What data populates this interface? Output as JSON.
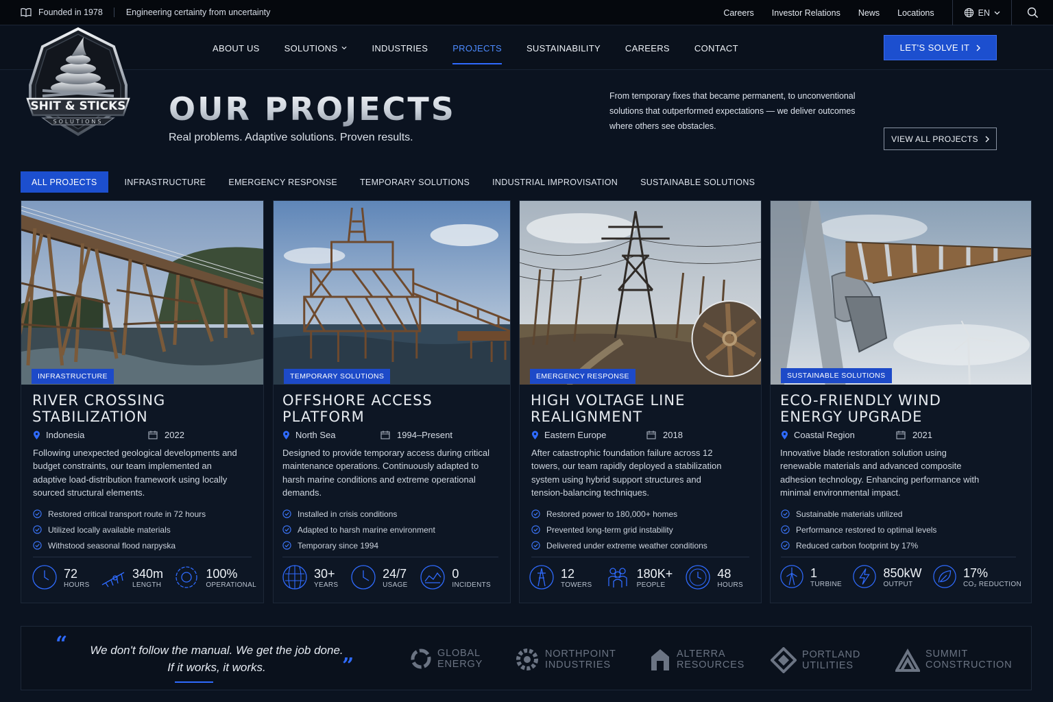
{
  "topbar": {
    "founded": "Founded in 1978",
    "tagline": "Engineering certainty from uncertainty",
    "links": [
      "Careers",
      "Investor Relations",
      "News",
      "Locations"
    ],
    "language": "EN"
  },
  "brand": {
    "name": "SHIT & STICKS",
    "sub": "SOLUTIONS"
  },
  "nav": {
    "items": [
      "ABOUT US",
      "SOLUTIONS",
      "INDUSTRIES",
      "PROJECTS",
      "SUSTAINABILITY",
      "CAREERS",
      "CONTACT"
    ],
    "active": "PROJECTS",
    "cta": "LET'S SOLVE IT"
  },
  "hero": {
    "title": "OUR PROJECTS",
    "subtitle": "Real problems. Adaptive solutions. Proven results.",
    "description": "From temporary fixes that became permanent, to unconventional solutions that outperformed expectations — we deliver outcomes where others see obstacles.",
    "view_all": "VIEW ALL PROJECTS"
  },
  "filters": [
    "ALL PROJECTS",
    "INFRASTRUCTURE",
    "EMERGENCY RESPONSE",
    "TEMPORARY SOLUTIONS",
    "INDUSTRIAL IMPROVISATION",
    "SUSTAINABLE SOLUTIONS"
  ],
  "projects": [
    {
      "badge": "INFRASTRUCTURE",
      "title_1": "RIVER CROSSING",
      "title_2": "STABILIZATION",
      "location": "Indonesia",
      "year": "2022",
      "description": "Following unexpected geological developments and budget constraints, our team implemented an adaptive load-distribution framework using locally sourced structural elements.",
      "checks": [
        "Restored critical transport route in 72 hours",
        "Utilized locally available materials",
        "Withstood seasonal flood narpyska"
      ],
      "stats": [
        {
          "value": "72",
          "label": "HOURS",
          "icon": "clock-icon"
        },
        {
          "value": "340m",
          "label": "LENGTH",
          "icon": "bridge-icon"
        },
        {
          "value": "100%",
          "label": "OPERATIONAL",
          "icon": "gear-icon"
        }
      ]
    },
    {
      "badge": "TEMPORARY SOLUTIONS",
      "title_1": "OFFSHORE ACCESS",
      "title_2": "PLATFORM",
      "location": "North Sea",
      "year": "1994–Present",
      "description": "Designed to provide temporary access during critical maintenance operations. Continuously adapted to harsh marine conditions and extreme operational demands.",
      "checks": [
        "Installed in crisis conditions",
        "Adapted to harsh marine environment",
        "Temporary since 1994"
      ],
      "stats": [
        {
          "value": "30+",
          "label": "YEARS",
          "icon": "globe-icon"
        },
        {
          "value": "24/7",
          "label": "USAGE",
          "icon": "clock-icon"
        },
        {
          "value": "0",
          "label": "INCIDENTS",
          "icon": "chart-icon"
        }
      ]
    },
    {
      "badge": "EMERGENCY RESPONSE",
      "title_1": "HIGH VOLTAGE LINE",
      "title_2": "REALIGNMENT",
      "location": "Eastern Europe",
      "year": "2018",
      "description": "After catastrophic foundation failure across 12 towers, our team rapidly deployed a stabilization system using hybrid support structures and tension-balancing techniques.",
      "checks": [
        "Restored power to 180,000+ homes",
        "Prevented long-term grid instability",
        "Delivered under extreme weather conditions"
      ],
      "stats": [
        {
          "value": "12",
          "label": "TOWERS",
          "icon": "tower-icon"
        },
        {
          "value": "180K+",
          "label": "PEOPLE",
          "icon": "people-icon"
        },
        {
          "value": "48",
          "label": "HOURS",
          "icon": "clock-icon"
        }
      ]
    },
    {
      "badge": "SUSTAINABLE SOLUTIONS",
      "title_1": "ECO-FRIENDLY WIND",
      "title_2": "ENERGY UPGRADE",
      "location": "Coastal Region",
      "year": "2021",
      "description": "Innovative blade restoration solution using renewable materials and advanced composite adhesion technology. Enhancing performance with minimal environmental impact.",
      "checks": [
        "Sustainable materials utilized",
        "Performance restored to optimal levels",
        "Reduced carbon footprint by 17%"
      ],
      "stats": [
        {
          "value": "1",
          "label": "TURBINE",
          "icon": "turbine-icon"
        },
        {
          "value": "850kW",
          "label": "OUTPUT",
          "icon": "bolt-icon"
        },
        {
          "value": "17%",
          "label": "CO₂ REDUCTION",
          "icon": "leaf-icon"
        }
      ]
    }
  ],
  "quote": {
    "line1": "We don't follow the manual. We get the job done.",
    "line2": "If it works, it works."
  },
  "partners": [
    {
      "l1": "GLOBAL",
      "l2": "ENERGY"
    },
    {
      "l1": "NORTHPOINT",
      "l2": "INDUSTRIES"
    },
    {
      "l1": "ALTERRA",
      "l2": "RESOURCES"
    },
    {
      "l1": "PORTLAND",
      "l2": "UTILITIES"
    },
    {
      "l1": "SUMMIT",
      "l2": "CONSTRUCTION"
    }
  ],
  "colors": {
    "accent": "#1c4fcf",
    "background": "#0b1320",
    "active_link": "#4d8bff"
  }
}
